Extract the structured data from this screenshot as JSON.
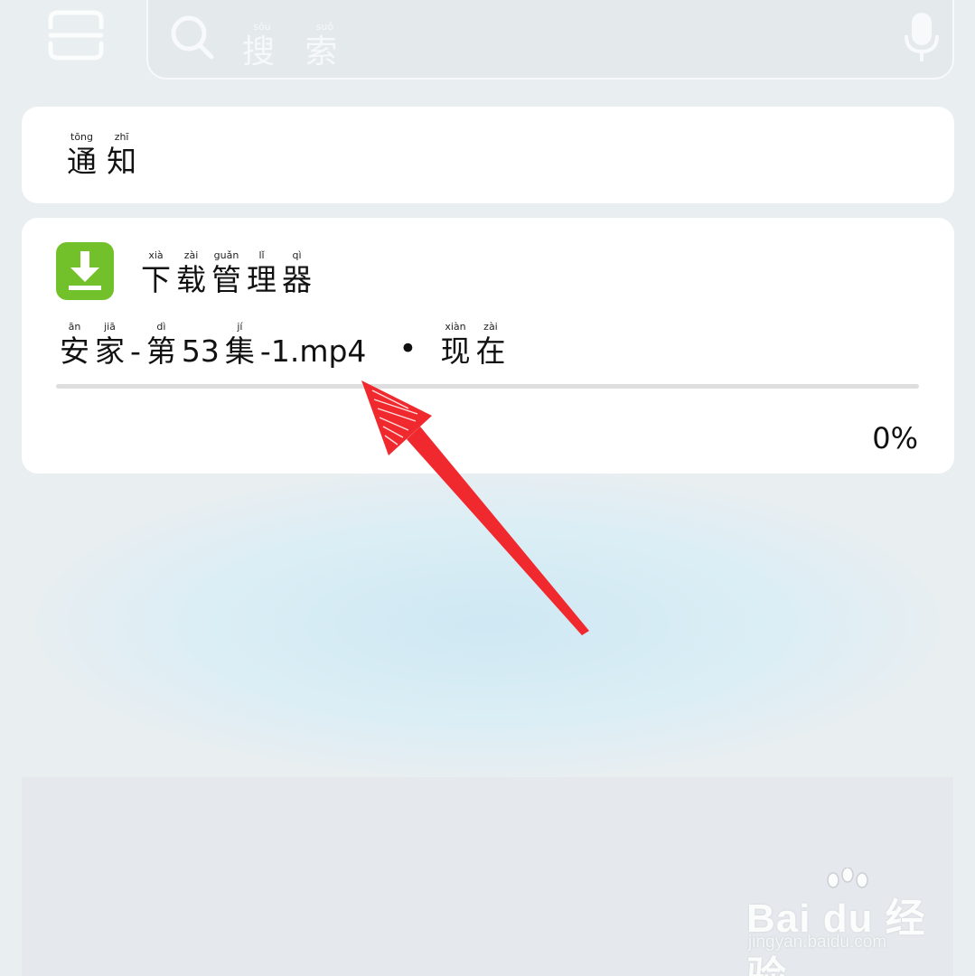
{
  "search": {
    "placeholder_pinyin": [
      "sōu",
      "suǒ"
    ],
    "placeholder_chars": [
      "搜",
      "索"
    ]
  },
  "notifications": {
    "header_pinyin": [
      "tōng",
      "zhī"
    ],
    "header_chars": [
      "通",
      "知"
    ]
  },
  "download_notification": {
    "app_name_pinyin": [
      "xià",
      "zài",
      "guǎn",
      "lǐ",
      "qì"
    ],
    "app_name_chars": [
      "下",
      "载",
      "管",
      "理",
      "器"
    ],
    "file_parts": [
      {
        "pin": "ān",
        "han": "安"
      },
      {
        "pin": "jiā",
        "han": "家"
      },
      {
        "pin": "",
        "han": "-"
      },
      {
        "pin": "dì",
        "han": "第"
      },
      {
        "pin": "",
        "han": "53"
      },
      {
        "pin": "jí",
        "han": "集"
      },
      {
        "pin": "",
        "han": "-1.mp4"
      }
    ],
    "separator": "•",
    "time_parts": [
      {
        "pin": "xiàn",
        "han": "现"
      },
      {
        "pin": "zài",
        "han": "在"
      }
    ],
    "progress_fraction": 0.0,
    "progress_label": "0%",
    "app_icon_color": "#73c12a"
  },
  "icons": {
    "scan": "scan-icon",
    "search": "search-icon",
    "mic": "microphone-icon",
    "app": "download-arrow-icon"
  },
  "annotation": {
    "color": "#f0292e",
    "shape": "arrow"
  },
  "watermark": {
    "logo_text": "Bai du 经验",
    "url": "jingyan.baidu.com"
  }
}
